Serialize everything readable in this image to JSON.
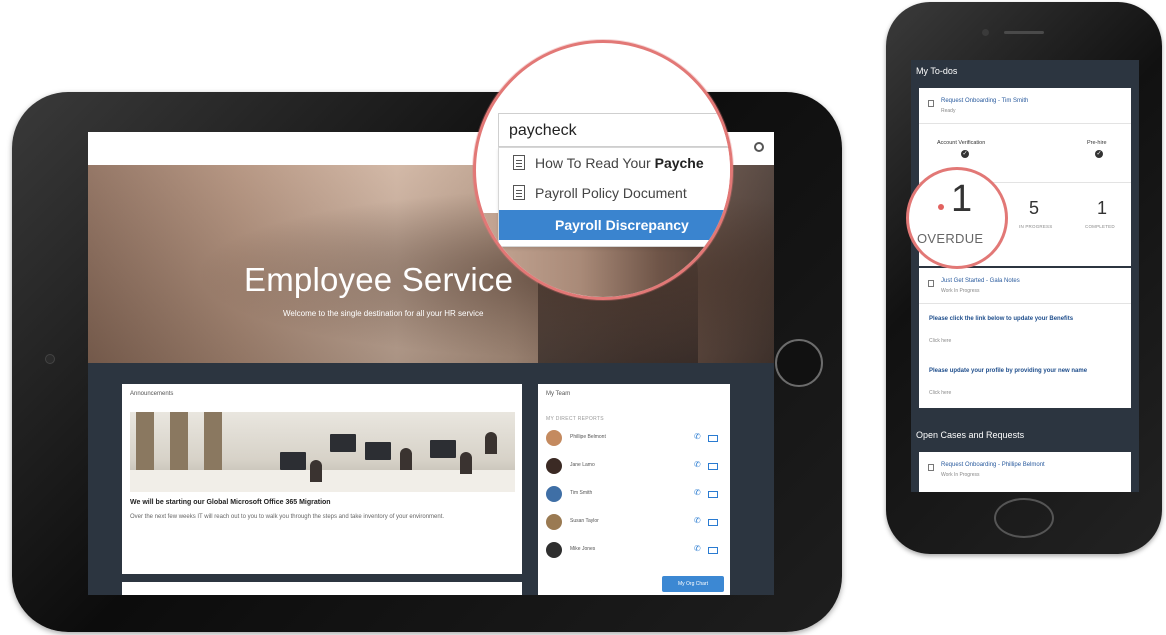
{
  "tablet": {
    "hero": {
      "title": "Employee Service",
      "subtitle": "Welcome to the single destination for all your HR service"
    },
    "announcements": {
      "title": "Announcements",
      "headline": "We will be starting our Global Microsoft Office 365 Migration",
      "body": "Over the next few weeks IT will reach out to you to walk you through the steps and take inventory of your environment."
    },
    "team": {
      "title": "My Team",
      "subheading": "MY DIRECT REPORTS",
      "members": [
        {
          "name": "Phillipe Belmont",
          "avatar_color": "#c48a5f"
        },
        {
          "name": "Jane Lamo",
          "avatar_color": "#3b2a24"
        },
        {
          "name": "Tim Smith",
          "avatar_color": "#3f6fa6"
        },
        {
          "name": "Susan Taylor",
          "avatar_color": "#9a7a52"
        },
        {
          "name": "Mike Jones",
          "avatar_color": "#2f2f2f"
        }
      ],
      "button": "My Org Chart"
    }
  },
  "magnifier": {
    "search_value": "paycheck",
    "results": [
      {
        "prefix": "How To Read Your ",
        "bold": "Payche"
      },
      {
        "prefix": "Payroll Policy Document",
        "bold": ""
      }
    ],
    "selected": "Payroll Discrepancy"
  },
  "phone": {
    "title": "My To-dos",
    "todo1": {
      "title": "Request Onboarding - Tim Smith",
      "status": "Ready"
    },
    "checks": [
      "Account Verification",
      "Pre-hire"
    ],
    "stats": [
      {
        "value": "5",
        "label": "IN PROGRESS"
      },
      {
        "value": "1",
        "label": "COMPLETED"
      }
    ],
    "todo2": {
      "title": "Just Get Started - Gala Notes",
      "status": "Work In Progress"
    },
    "task1": {
      "title": "Please click the link below to update your Benefits",
      "action": "Click here"
    },
    "task2": {
      "title": "Please update your profile by providing your new name",
      "action": "Click here"
    },
    "section2_title": "Open Cases and Requests",
    "case1": {
      "title": "Request Onboarding - Phillipe Belmont",
      "status": "Work In Progress"
    }
  },
  "overdue": {
    "value": "1",
    "label": "OVERDUE"
  },
  "colors": {
    "accent": "#3a84cf",
    "highlight_ring": "#e27876",
    "dark_panel": "#2c3540"
  }
}
